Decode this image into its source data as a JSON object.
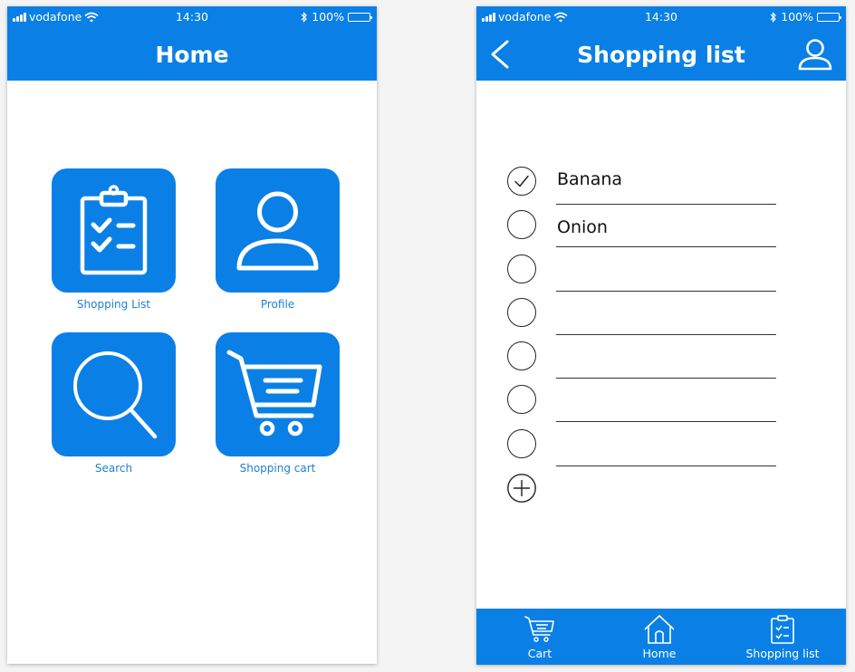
{
  "colors": {
    "accent": "#0a80e6",
    "label_blue": "#1e7fd6",
    "white": "#ffffff"
  },
  "status_bar": {
    "carrier": "vodafone",
    "time": "14:30",
    "battery": "100%"
  },
  "home_screen": {
    "title": "Home",
    "tiles": [
      {
        "label": "Shopping List",
        "icon": "clipboard-checklist-icon"
      },
      {
        "label": "Profile",
        "icon": "user-icon"
      },
      {
        "label": "Search",
        "icon": "magnifier-icon"
      },
      {
        "label": "Shopping cart",
        "icon": "shopping-cart-icon"
      }
    ]
  },
  "list_screen": {
    "title": "Shopping list",
    "back_icon": "chevron-left-icon",
    "profile_icon": "user-icon",
    "items": [
      {
        "text": "Banana",
        "checked": true
      },
      {
        "text": "Onion",
        "checked": false
      },
      {
        "text": "",
        "checked": false
      },
      {
        "text": "",
        "checked": false
      },
      {
        "text": "",
        "checked": false
      },
      {
        "text": "",
        "checked": false
      },
      {
        "text": "",
        "checked": false
      }
    ],
    "add_icon": "plus-circle-icon",
    "tab_bar": [
      {
        "label": "Cart",
        "icon": "cart-icon"
      },
      {
        "label": "Home",
        "icon": "house-icon"
      },
      {
        "label": "Shopping list",
        "icon": "clipboard-icon"
      }
    ]
  }
}
